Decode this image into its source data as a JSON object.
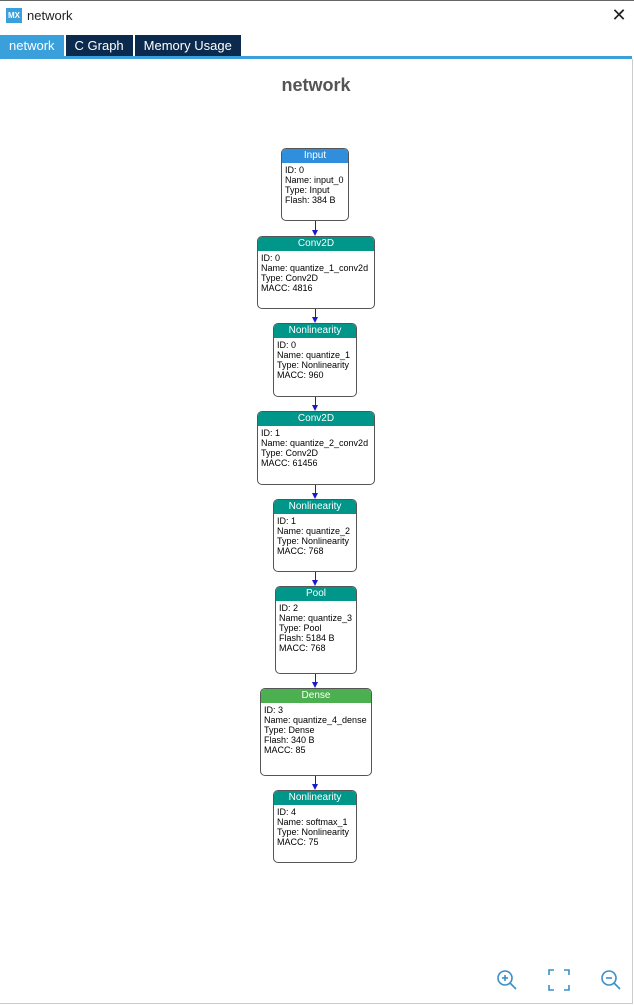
{
  "window": {
    "logo": "MX",
    "title": "network",
    "close_icon": "close-icon"
  },
  "tabs": [
    {
      "label": "network",
      "active": true
    },
    {
      "label": "C Graph",
      "active": false
    },
    {
      "label": "Memory Usage",
      "active": false
    }
  ],
  "graph": {
    "title": "network",
    "colors": {
      "input": "#2f8fdc",
      "layer": "#00968a",
      "dense": "#4caf50",
      "edge": "#1a1acc"
    },
    "nodes": [
      {
        "header": "Input",
        "kind": "input",
        "lines": [
          "ID: 0",
          "Name: input_0",
          "Type: Input",
          "Flash: 384 B"
        ]
      },
      {
        "header": "Conv2D",
        "kind": "layer",
        "lines": [
          "ID: 0",
          "Name: quantize_1_conv2d",
          "Type: Conv2D",
          "MACC: 4816"
        ]
      },
      {
        "header": "Nonlinearity",
        "kind": "layer",
        "lines": [
          "ID: 0",
          "Name: quantize_1",
          "Type: Nonlinearity",
          "MACC: 960"
        ]
      },
      {
        "header": "Conv2D",
        "kind": "layer",
        "lines": [
          "ID: 1",
          "Name: quantize_2_conv2d",
          "Type: Conv2D",
          "MACC: 61456"
        ]
      },
      {
        "header": "Nonlinearity",
        "kind": "layer",
        "lines": [
          "ID: 1",
          "Name: quantize_2",
          "Type: Nonlinearity",
          "MACC: 768"
        ]
      },
      {
        "header": "Pool",
        "kind": "layer",
        "lines": [
          "ID: 2",
          "Name: quantize_3",
          "Type: Pool",
          "Flash: 5184 B",
          "MACC: 768"
        ]
      },
      {
        "header": "Dense",
        "kind": "dense",
        "lines": [
          "ID: 3",
          "Name: quantize_4_dense",
          "Type: Dense",
          "Flash: 340 B",
          "MACC: 85"
        ]
      },
      {
        "header": "Nonlinearity",
        "kind": "layer",
        "lines": [
          "ID: 4",
          "Name: softmax_1",
          "Type: Nonlinearity",
          "MACC: 75"
        ]
      }
    ]
  },
  "controls": {
    "zoom_in_icon": "zoom-in-icon",
    "fit_icon": "fit-screen-icon",
    "zoom_out_icon": "zoom-out-icon"
  }
}
